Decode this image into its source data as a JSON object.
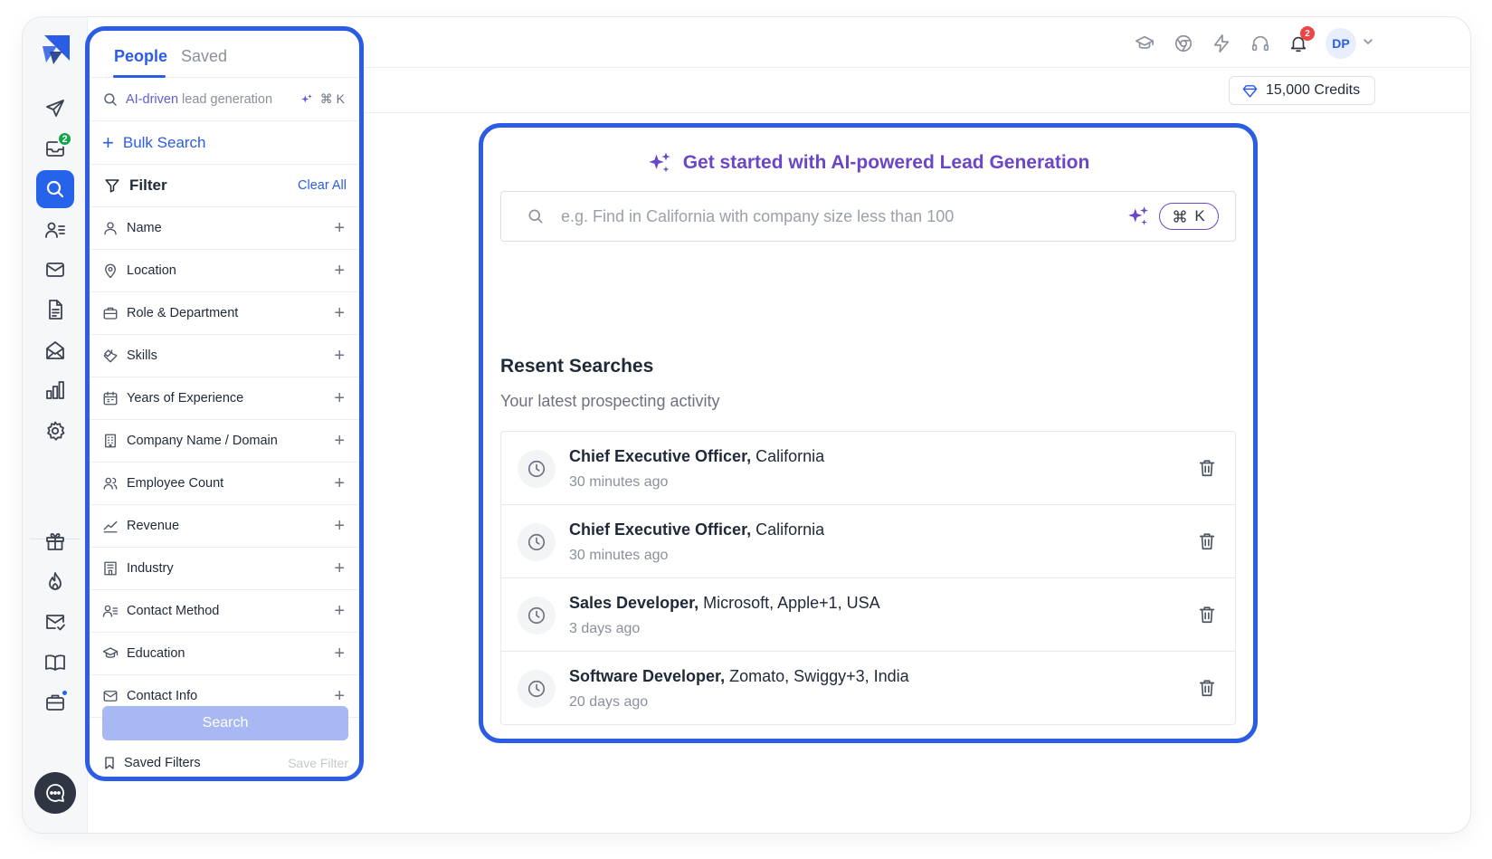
{
  "rail": {
    "inbox_badge": "2",
    "items": [
      "send-icon",
      "inbox-icon",
      "search-icon",
      "contacts-icon",
      "mail-icon",
      "document-icon",
      "envelope-open-icon",
      "bar-chart-icon",
      "gear-icon",
      "gift-icon",
      "fire-icon",
      "mail-check-icon",
      "book-icon",
      "briefcase-icon",
      "chat-icon"
    ],
    "active": "search-icon"
  },
  "panel": {
    "tabs": [
      {
        "label": "People"
      },
      {
        "label": "Saved"
      }
    ],
    "search": {
      "highlight": "AI-driven",
      "rest": " lead generation",
      "kbd": "⌘ K"
    },
    "bulk_search": "Bulk Search",
    "filter_title": "Filter",
    "clear_all": "Clear All",
    "filters": [
      {
        "label": "Name",
        "icon": "user-icon"
      },
      {
        "label": "Location",
        "icon": "location-pin-icon"
      },
      {
        "label": "Role & Department",
        "icon": "briefcase-icon"
      },
      {
        "label": "Skills",
        "icon": "wrench-icon"
      },
      {
        "label": "Years of Experience",
        "icon": "calendar-icon"
      },
      {
        "label": "Company Name / Domain",
        "icon": "building-icon"
      },
      {
        "label": "Employee Count",
        "icon": "users-icon"
      },
      {
        "label": "Revenue",
        "icon": "trend-icon"
      },
      {
        "label": "Industry",
        "icon": "factory-icon"
      },
      {
        "label": "Contact Method",
        "icon": "contact-list-icon"
      },
      {
        "label": "Education",
        "icon": "graduation-cap-icon"
      },
      {
        "label": "Contact Info",
        "icon": "mail-icon"
      }
    ],
    "search_button": "Search",
    "saved_filters": "Saved Filters",
    "save_filter": "Save Filter"
  },
  "topbar": {
    "icons": [
      "graduation-cap-icon",
      "chrome-icon",
      "lightning-icon",
      "headset-icon",
      "bell-icon"
    ],
    "bell_badge": "2",
    "avatar": "DP"
  },
  "credits": "15,000 Credits",
  "ai_card": {
    "title": "Get started with AI-powered Lead Generation",
    "placeholder": "e.g. Find in California with company size less than 100",
    "kbd": "K"
  },
  "recent": {
    "title": "Resent Searches",
    "subtitle": "Your latest prospecting activity",
    "items": [
      {
        "role": "Chief Executive Officer,",
        "detail": " California",
        "time": "30 minutes ago"
      },
      {
        "role": "Chief Executive Officer,",
        "detail": " California",
        "time": "30 minutes ago"
      },
      {
        "role": "Sales Developer,",
        "detail": " Microsoft, Apple+1, USA",
        "time": "3 days ago"
      },
      {
        "role": "Software Developer,",
        "detail": " Zomato, Swiggy+3, India",
        "time": "20 days ago"
      }
    ]
  },
  "colors": {
    "primary": "#2b5ce6",
    "ai_purple": "#6a46c8",
    "badge_green": "#16a34a",
    "badge_red": "#ef4444"
  }
}
